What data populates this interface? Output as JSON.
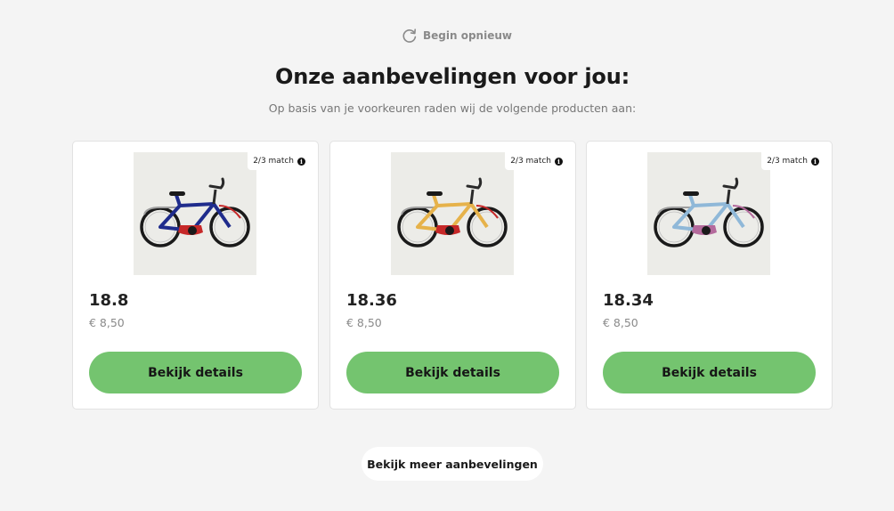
{
  "header": {
    "restart_label": "Begin opnieuw",
    "title": "Onze aanbevelingen voor jou:",
    "subtitle": "Op basis van je voorkeuren raden wij de volgende producten aan:"
  },
  "products": [
    {
      "match": "2/3 match",
      "name": "18.8",
      "price": "€ 8,50",
      "button": "Bekijk details",
      "bike_frame_color": "#1f2c8c",
      "bike_accent_color": "#c62828",
      "icon": "bicycle-image"
    },
    {
      "match": "2/3 match",
      "name": "18.36",
      "price": "€ 8,50",
      "button": "Bekijk details",
      "bike_frame_color": "#e6b24a",
      "bike_accent_color": "#c62828",
      "icon": "bicycle-image"
    },
    {
      "match": "2/3 match",
      "name": "18.34",
      "price": "€ 8,50",
      "button": "Bekijk details",
      "bike_frame_color": "#8fb8d8",
      "bike_accent_color": "#b46a9c",
      "icon": "bicycle-image"
    }
  ],
  "footer": {
    "more_label": "Bekijk meer aanbevelingen"
  },
  "colors": {
    "background": "#f4f4f4",
    "button_green": "#74c46f",
    "card_border": "#e2e2e2"
  }
}
